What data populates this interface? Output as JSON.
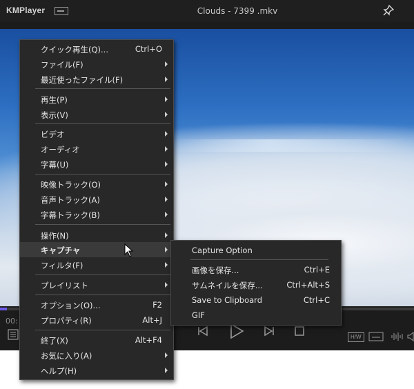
{
  "app": {
    "logo": "KMPlayer",
    "title": "Clouds - 7399 .mkv"
  },
  "player": {
    "time": "00:"
  },
  "badges": {
    "hw": "H/W",
    "sub": "▭"
  },
  "main_menu": {
    "items": [
      {
        "label": "クイック再生(Q)...",
        "shortcut": "Ctrl+O"
      },
      {
        "label": "ファイル(F)"
      },
      {
        "label": "最近使ったファイル(F)"
      },
      {
        "label": "再生(P)"
      },
      {
        "label": "表示(V)"
      },
      {
        "label": "ビデオ"
      },
      {
        "label": "オーディオ"
      },
      {
        "label": "字幕(U)"
      },
      {
        "label": "映像トラック(O)"
      },
      {
        "label": "音声トラック(A)"
      },
      {
        "label": "字幕トラック(B)"
      },
      {
        "label": "操作(N)"
      },
      {
        "label": "キャプチャ"
      },
      {
        "label": "フィルタ(F)"
      },
      {
        "label": "プレイリスト"
      },
      {
        "label": "オプション(O)...",
        "shortcut": "F2"
      },
      {
        "label": "プロパティ(R)",
        "shortcut": "Alt+J"
      },
      {
        "label": "終了(X)",
        "shortcut": "Alt+F4"
      },
      {
        "label": "お気に入り(A)"
      },
      {
        "label": "ヘルプ(H)"
      }
    ]
  },
  "capture_menu": {
    "items": [
      {
        "label": "Capture Option"
      },
      {
        "label": "画像を保存...",
        "shortcut": "Ctrl+E"
      },
      {
        "label": "サムネイルを保存...",
        "shortcut": "Ctrl+Alt+S"
      },
      {
        "label": "Save to Clipboard",
        "shortcut": "Ctrl+C"
      },
      {
        "label": "GIF"
      }
    ]
  },
  "icons": {
    "pin": "pin-icon",
    "prev": "previous-track-icon",
    "play": "play-icon",
    "next": "next-track-icon",
    "stop": "stop-icon",
    "playlist": "playlist-icon",
    "equalizer": "equalizer-icon",
    "cursor": "mouse-pointer-icon"
  },
  "colors": {
    "seek_fill": "#6c5ce7",
    "menu_bg": "#282828",
    "highlight": "#3a3a3a"
  }
}
